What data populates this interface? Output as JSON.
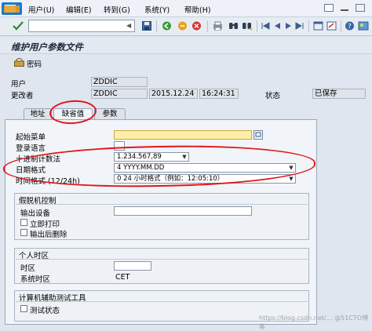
{
  "menu": {
    "items": [
      "用户(U)",
      "编辑(E)",
      "转到(G)",
      "系统(Y)",
      "帮助(H)"
    ]
  },
  "toolbar": {
    "icons": [
      "check-icon",
      "save-icon",
      "back-icon",
      "exit-icon",
      "cancel-icon",
      "print-icon",
      "find-icon",
      "find-next-icon",
      "first-page-icon",
      "prev-page-icon",
      "next-page-icon",
      "last-page-icon",
      "new-session-icon",
      "shortcut-icon",
      "help-icon",
      "layout-icon"
    ],
    "command_value": ""
  },
  "title": "维护用户参数文件",
  "app_toolbar": {
    "password_label": "密码"
  },
  "header": {
    "user_label": "用户",
    "user_value": "ZDDIC",
    "changed_by_label": "更改者",
    "changed_by_value": "ZDDIC",
    "date": "2015.12.24",
    "time": "16:24:31",
    "status_label": "状态",
    "status_value": "已保存"
  },
  "tabs": [
    "地址",
    "缺省值",
    "参数"
  ],
  "defaults": {
    "start_menu_label": "起始菜单",
    "start_menu_value": "",
    "logon_language_label": "登录语言",
    "decimal_label": "十进制计数法",
    "decimal_value": "1.234.567,89",
    "date_format_label": "日期格式",
    "date_format_value": "4 YYYY.MM.DD",
    "time_format_label": "时间格式 (12/24h)",
    "time_format_value": "0 24 小时格式（例如：12:05:10）"
  },
  "spool": {
    "title": "假脱机控制",
    "output_device_label": "输出设备",
    "print_now_label": "立即打印",
    "delete_after_label": "输出后删除"
  },
  "timezone": {
    "title": "个人时区",
    "tz_label": "时区",
    "tz_value": "",
    "sys_tz_label": "系统时区",
    "sys_tz_value": "CET"
  },
  "cat": {
    "title": "计算机辅助测试工具",
    "test_status_label": "测试状态"
  },
  "watermark": "https://blog.csdn.net/… @51CTO博客"
}
